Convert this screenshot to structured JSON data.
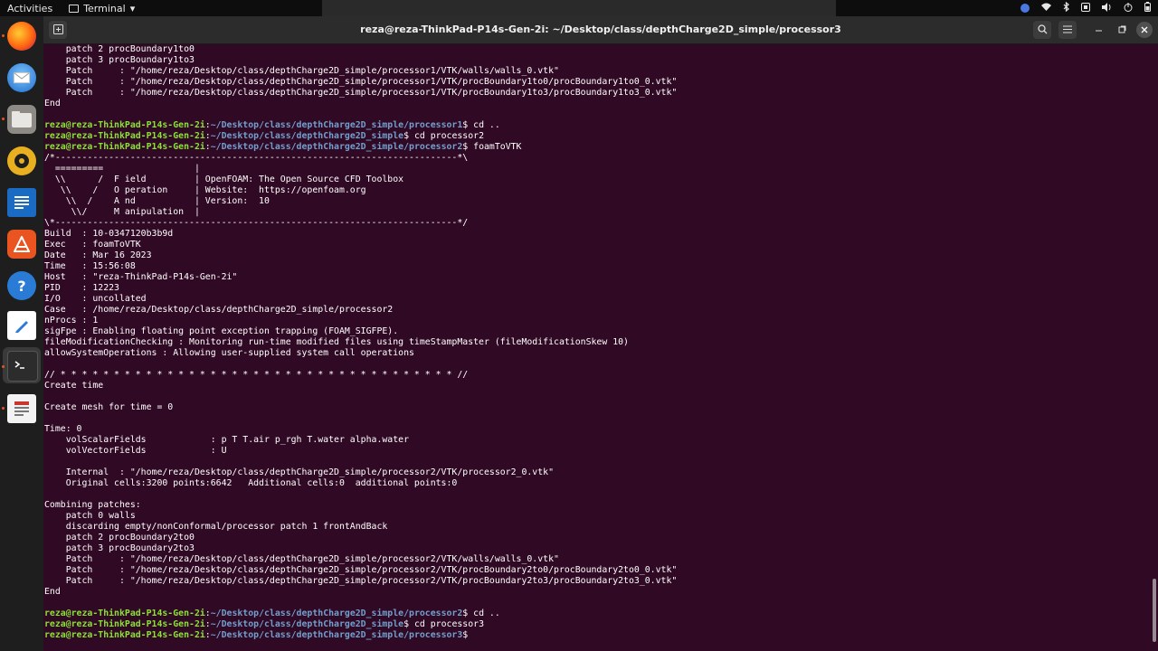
{
  "topbar": {
    "activities": "Activities",
    "app_name": "Terminal",
    "app_chevron": "▾",
    "tray_icons": [
      "accessibility-icon",
      "network-icon",
      "bluetooth-icon",
      "volume-icon",
      "power-icon"
    ]
  },
  "dock": {
    "items": [
      "firefox-icon",
      "thunderbird-icon",
      "files-icon",
      "rhythmbox-icon",
      "writer-icon",
      "app-center-icon",
      "help-icon",
      "text-editor-icon",
      "terminal-icon",
      "doc-viewer-icon"
    ]
  },
  "window": {
    "title": "reza@reza-ThinkPad-P14s-Gen-2i: ~/Desktop/class/depthCharge2D_simple/processor3"
  },
  "colors": {
    "background": "#300a24",
    "user": "#8ae234",
    "path": "#729fcf",
    "text": "#ffffff"
  },
  "terminal": {
    "lines": [
      {
        "t": "    patch 2 procBoundary1to0"
      },
      {
        "t": "    patch 3 procBoundary1to3"
      },
      {
        "t": "    Patch     : \"/home/reza/Desktop/class/depthCharge2D_simple/processor1/VTK/walls/walls_0.vtk\""
      },
      {
        "t": "    Patch     : \"/home/reza/Desktop/class/depthCharge2D_simple/processor1/VTK/procBoundary1to0/procBoundary1to0_0.vtk\""
      },
      {
        "t": "    Patch     : \"/home/reza/Desktop/class/depthCharge2D_simple/processor1/VTK/procBoundary1to3/procBoundary1to3_0.vtk\""
      },
      {
        "t": "End"
      },
      {
        "t": ""
      },
      {
        "u": "reza@reza-ThinkPad-P14s-Gen-2i",
        "p": "~/Desktop/class/depthCharge2D_simple/processor1",
        "c": "cd .."
      },
      {
        "u": "reza@reza-ThinkPad-P14s-Gen-2i",
        "p": "~/Desktop/class/depthCharge2D_simple",
        "c": "cd processor2"
      },
      {
        "u": "reza@reza-ThinkPad-P14s-Gen-2i",
        "p": "~/Desktop/class/depthCharge2D_simple/processor2",
        "c": "foamToVTK"
      },
      {
        "t": "/*---------------------------------------------------------------------------*\\"
      },
      {
        "t": "  =========                 |"
      },
      {
        "t": "  \\\\      /  F ield         | OpenFOAM: The Open Source CFD Toolbox"
      },
      {
        "t": "   \\\\    /   O peration     | Website:  https://openfoam.org"
      },
      {
        "t": "    \\\\  /    A nd           | Version:  10"
      },
      {
        "t": "     \\\\/     M anipulation  |"
      },
      {
        "t": "\\*---------------------------------------------------------------------------*/"
      },
      {
        "t": "Build  : 10-0347120b3b9d"
      },
      {
        "t": "Exec   : foamToVTK"
      },
      {
        "t": "Date   : Mar 16 2023"
      },
      {
        "t": "Time   : 15:56:08"
      },
      {
        "t": "Host   : \"reza-ThinkPad-P14s-Gen-2i\""
      },
      {
        "t": "PID    : 12223"
      },
      {
        "t": "I/O    : uncollated"
      },
      {
        "t": "Case   : /home/reza/Desktop/class/depthCharge2D_simple/processor2"
      },
      {
        "t": "nProcs : 1"
      },
      {
        "t": "sigFpe : Enabling floating point exception trapping (FOAM_SIGFPE)."
      },
      {
        "t": "fileModificationChecking : Monitoring run-time modified files using timeStampMaster (fileModificationSkew 10)"
      },
      {
        "t": "allowSystemOperations : Allowing user-supplied system call operations"
      },
      {
        "t": ""
      },
      {
        "t": "// * * * * * * * * * * * * * * * * * * * * * * * * * * * * * * * * * * * * * //"
      },
      {
        "t": "Create time"
      },
      {
        "t": ""
      },
      {
        "t": "Create mesh for time = 0"
      },
      {
        "t": ""
      },
      {
        "t": "Time: 0"
      },
      {
        "t": "    volScalarFields            : p T T.air p_rgh T.water alpha.water"
      },
      {
        "t": "    volVectorFields            : U"
      },
      {
        "t": ""
      },
      {
        "t": "    Internal  : \"/home/reza/Desktop/class/depthCharge2D_simple/processor2/VTK/processor2_0.vtk\""
      },
      {
        "t": "    Original cells:3200 points:6642   Additional cells:0  additional points:0"
      },
      {
        "t": ""
      },
      {
        "t": "Combining patches:"
      },
      {
        "t": "    patch 0 walls"
      },
      {
        "t": "    discarding empty/nonConformal/processor patch 1 frontAndBack"
      },
      {
        "t": "    patch 2 procBoundary2to0"
      },
      {
        "t": "    patch 3 procBoundary2to3"
      },
      {
        "t": "    Patch     : \"/home/reza/Desktop/class/depthCharge2D_simple/processor2/VTK/walls/walls_0.vtk\""
      },
      {
        "t": "    Patch     : \"/home/reza/Desktop/class/depthCharge2D_simple/processor2/VTK/procBoundary2to0/procBoundary2to0_0.vtk\""
      },
      {
        "t": "    Patch     : \"/home/reza/Desktop/class/depthCharge2D_simple/processor2/VTK/procBoundary2to3/procBoundary2to3_0.vtk\""
      },
      {
        "t": "End"
      },
      {
        "t": ""
      },
      {
        "u": "reza@reza-ThinkPad-P14s-Gen-2i",
        "p": "~/Desktop/class/depthCharge2D_simple/processor2",
        "c": "cd .."
      },
      {
        "u": "reza@reza-ThinkPad-P14s-Gen-2i",
        "p": "~/Desktop/class/depthCharge2D_simple",
        "c": "cd processor3"
      },
      {
        "u": "reza@reza-ThinkPad-P14s-Gen-2i",
        "p": "~/Desktop/class/depthCharge2D_simple/processor3",
        "c": ""
      }
    ]
  }
}
